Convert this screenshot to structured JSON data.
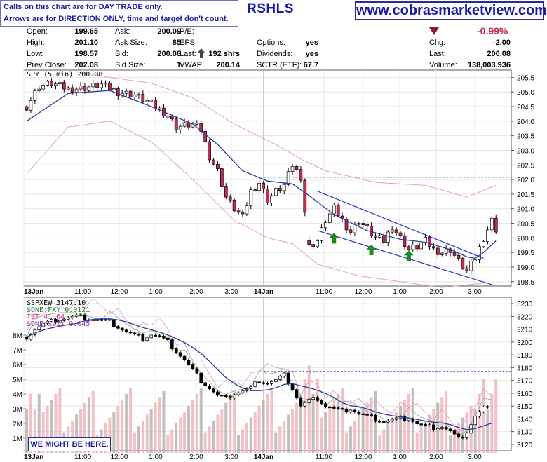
{
  "header": {
    "note_line1": "Calls on this chart are for DAY TRADE only.",
    "note_line2": "Arrows are for DIRECTION ONLY, time and target don't count.",
    "ticker": "RSHLS",
    "site": "www.cobrasmarketview.com",
    "change_pct": "-0.99%"
  },
  "quote": {
    "open_label": "Open:",
    "open": "199.65",
    "high_label": "High:",
    "high": "201.10",
    "low_label": "Low:",
    "low": "198.57",
    "prev_label": "Prev Close:",
    "prev": "202.08",
    "ask_label": "Ask:",
    "ask": "200.09",
    "asksize_label": "Ask Size:",
    "asksize": "85",
    "bid_label": "Bid:",
    "bid": "200.08",
    "bidsize_label": "Bid Size:",
    "bidsize": "1",
    "pe_label": "P/E:",
    "eps_label": "EPS:",
    "last_label": "Last:",
    "last_shrs": "192 shrs",
    "vwap_label": "VWAP:",
    "vwap": "200.14",
    "options_label": "Options:",
    "options": "yes",
    "dividends_label": "Dividends:",
    "dividends": "yes",
    "sctr_label": "SCTR (ETF):",
    "sctr": "67.7",
    "chg_label": "Chg:",
    "chg": "-2.00",
    "last2_label": "Last:",
    "last2": "200.08",
    "volume_label": "Volume:",
    "volume": "138,003,936"
  },
  "watermark": "WE MIGHT BE HERE.",
  "colors": {
    "up": "#ffffff",
    "down": "#c8294f",
    "ma": "#2a3a9a",
    "bands": "#e8a0b8",
    "channel": "#2233cc",
    "arrow": "#1c8a1c",
    "vol_down": "#f0b0b8",
    "vol_up": "#b0b0b0"
  },
  "chart_data": [
    {
      "type": "candlestick",
      "title": "SPY (5 min) 200.08",
      "x_labels": [
        "13Jan",
        "11:00",
        "12:00",
        "1:00",
        "2:00",
        "3:00",
        "14Jan",
        "11:00",
        "12:00",
        "1:00",
        "2:00",
        "3:00"
      ],
      "y_ticks": [
        "205.5",
        "205.0",
        "204.5",
        "204.0",
        "203.5",
        "203.0",
        "202.5",
        "202.0",
        "201.5",
        "201.0",
        "200.5",
        "200.0",
        "199.5",
        "199.0",
        "198.5"
      ],
      "ylim": [
        198.35,
        205.75
      ],
      "prev_close_line": 202.08,
      "close_path": [
        [
          0,
          204.5
        ],
        [
          3,
          205.2
        ],
        [
          6,
          205.3
        ],
        [
          10,
          205.1
        ],
        [
          14,
          205.15
        ],
        [
          18,
          205.25
        ],
        [
          22,
          205.0
        ],
        [
          26,
          204.9
        ],
        [
          30,
          204.6
        ],
        [
          34,
          204.2
        ],
        [
          36,
          203.8
        ],
        [
          38,
          203.85
        ],
        [
          40,
          203.9
        ],
        [
          42,
          203.7
        ],
        [
          44,
          202.8
        ],
        [
          46,
          202.3
        ],
        [
          48,
          201.4
        ],
        [
          50,
          201.0
        ],
        [
          52,
          200.7
        ],
        [
          54,
          201.6
        ],
        [
          56,
          201.9
        ],
        [
          58,
          201.3
        ],
        [
          60,
          201.6
        ],
        [
          62,
          201.8
        ],
        [
          64,
          202.5
        ],
        [
          66,
          202.1
        ],
        [
          68,
          199.7
        ],
        [
          70,
          199.9
        ],
        [
          72,
          200.6
        ],
        [
          74,
          201.0
        ],
        [
          76,
          200.6
        ],
        [
          78,
          200.2
        ],
        [
          80,
          200.6
        ],
        [
          82,
          200.3
        ],
        [
          84,
          200.0
        ],
        [
          86,
          199.9
        ],
        [
          88,
          200.4
        ],
        [
          90,
          200.0
        ],
        [
          92,
          199.6
        ],
        [
          94,
          199.7
        ],
        [
          96,
          199.9
        ],
        [
          98,
          199.6
        ],
        [
          100,
          199.5
        ],
        [
          102,
          199.6
        ],
        [
          104,
          199.2
        ],
        [
          106,
          198.85
        ],
        [
          108,
          199.3
        ],
        [
          110,
          200.0
        ],
        [
          112,
          200.6
        ],
        [
          113,
          200.3
        ]
      ],
      "ma_path": [
        [
          0,
          204.0
        ],
        [
          10,
          204.95
        ],
        [
          20,
          205.05
        ],
        [
          30,
          204.5
        ],
        [
          40,
          203.9
        ],
        [
          46,
          203.2
        ],
        [
          52,
          202.3
        ],
        [
          58,
          201.95
        ],
        [
          64,
          201.85
        ],
        [
          68,
          201.45
        ],
        [
          74,
          200.8
        ],
        [
          82,
          200.25
        ],
        [
          90,
          199.95
        ],
        [
          96,
          199.85
        ],
        [
          102,
          199.6
        ],
        [
          106,
          199.35
        ],
        [
          108,
          199.3
        ],
        [
          110,
          199.5
        ],
        [
          113,
          199.9
        ]
      ],
      "upper_band": [
        [
          12,
          205.7
        ],
        [
          20,
          205.5
        ],
        [
          30,
          205.3
        ],
        [
          40,
          204.8
        ],
        [
          50,
          203.9
        ],
        [
          60,
          203.2
        ],
        [
          66,
          202.7
        ],
        [
          72,
          202.3
        ],
        [
          84,
          201.9
        ],
        [
          96,
          201.8
        ],
        [
          106,
          201.4
        ],
        [
          113,
          201.8
        ]
      ],
      "lower_band": [
        [
          0,
          202.2
        ],
        [
          10,
          203.8
        ],
        [
          20,
          204.0
        ],
        [
          30,
          203.3
        ],
        [
          40,
          202.0
        ],
        [
          50,
          200.6
        ],
        [
          58,
          200.0
        ],
        [
          64,
          199.8
        ],
        [
          70,
          199.1
        ],
        [
          80,
          198.7
        ],
        [
          90,
          198.5
        ],
        [
          100,
          198.3
        ],
        [
          110,
          198.45
        ]
      ],
      "channel_upper": [
        [
          70,
          201.6
        ],
        [
          110,
          199.3
        ]
      ],
      "channel_lower": [
        [
          70,
          200.25
        ],
        [
          112,
          198.4
        ]
      ],
      "arrows_at": [
        [
          74,
          199.95
        ],
        [
          83,
          199.55
        ],
        [
          92,
          199.35
        ]
      ]
    },
    {
      "type": "line",
      "title": "$SPXEW 3147.10",
      "series": [
        {
          "name": "$SPXEW",
          "values": [
            3204,
            3210,
            3214,
            3216,
            3218,
            3219,
            3220,
            3219,
            3218,
            3217,
            3216,
            3212,
            3208,
            3205,
            3203,
            3206,
            3204,
            3200,
            3193,
            3186,
            3178,
            3170,
            3164,
            3158,
            3156,
            3160,
            3162,
            3164,
            3170,
            3168,
            3170,
            3174,
            3164,
            3150,
            3154,
            3156,
            3150,
            3148,
            3146,
            3148,
            3144,
            3142,
            3140,
            3138,
            3139,
            3140,
            3141,
            3136,
            3134,
            3133,
            3134,
            3130,
            3124,
            3130,
            3142,
            3148
          ]
        },
        {
          "name": "$ONE:FXY 0.0121",
          "values": []
        },
        {
          "name": "TBT 41.64",
          "values": []
        },
        {
          "name": "$ONE:$VIX 0.045",
          "values": []
        }
      ],
      "y_ticks": [
        "3230",
        "3220",
        "3210",
        "3200",
        "3190",
        "3180",
        "3170",
        "3160",
        "3150",
        "3140",
        "3130",
        "3120"
      ],
      "ylim": [
        3115,
        3235
      ],
      "volume_ticks": [
        "8M",
        "7M",
        "6M",
        "5M",
        "4M",
        "3M",
        "2M",
        "1M"
      ],
      "x_labels": [
        "13Jan",
        "11:00",
        "12:00",
        "1:00",
        "2:00",
        "3:00",
        "14Jan",
        "11:00",
        "12:00",
        "1:00",
        "2:00",
        "3:00"
      ]
    }
  ]
}
